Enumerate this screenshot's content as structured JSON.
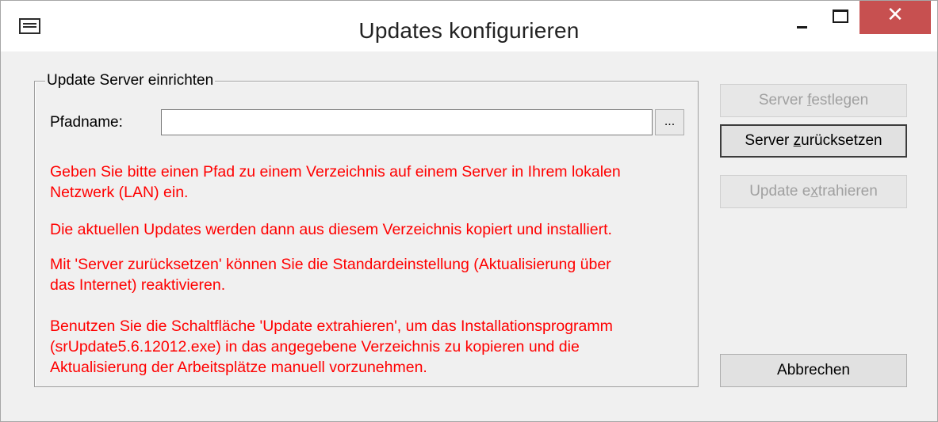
{
  "window": {
    "title": "Updates  konfigurieren",
    "close_glyph": "✕"
  },
  "group": {
    "legend": "Update Server einrichten",
    "path_label": "Pfadname:",
    "path_value": "",
    "browse_label": "..."
  },
  "info": {
    "para1_line1": "Geben Sie bitte einen Pfad zu einem Verzeichnis auf einem Server in Ihrem lokalen",
    "para1_line2": "Netzwerk (LAN) ein.",
    "para2_line1": "Die aktuellen Updates werden dann aus diesem Verzeichnis kopiert und installiert.",
    "para3_line1": "Mit 'Server zurücksetzen' können Sie die Standardeinstellung (Aktualisierung über",
    "para3_line2": "das Internet) reaktivieren.",
    "para4_line1": "Benutzen Sie die Schaltfläche 'Update extrahieren', um das Installationsprogramm",
    "para4_line2": "(srUpdate5.6.12012.exe) in das angegebene Verzeichnis zu kopieren und die",
    "para4_line3": "Aktualisierung der Arbeitsplätze manuell vorzunehmen."
  },
  "buttons": {
    "set_server": {
      "pre": "Server ",
      "accel": "f",
      "post": "estlegen",
      "enabled": false
    },
    "reset_server": {
      "pre": "Server ",
      "accel": "z",
      "post": "urücksetzen",
      "enabled": true
    },
    "extract_update": {
      "pre": "Update e",
      "accel": "x",
      "post": "trahieren",
      "enabled": false
    },
    "cancel": "Abbrechen"
  },
  "icons": {
    "system_menu": "system-menu-icon",
    "minimize": "minimize-icon",
    "maximize": "maximize-icon",
    "close": "close-icon"
  },
  "colors": {
    "info_text": "#ff0000",
    "close_button": "#c75050",
    "dialog_background": "#f0f0f0"
  }
}
